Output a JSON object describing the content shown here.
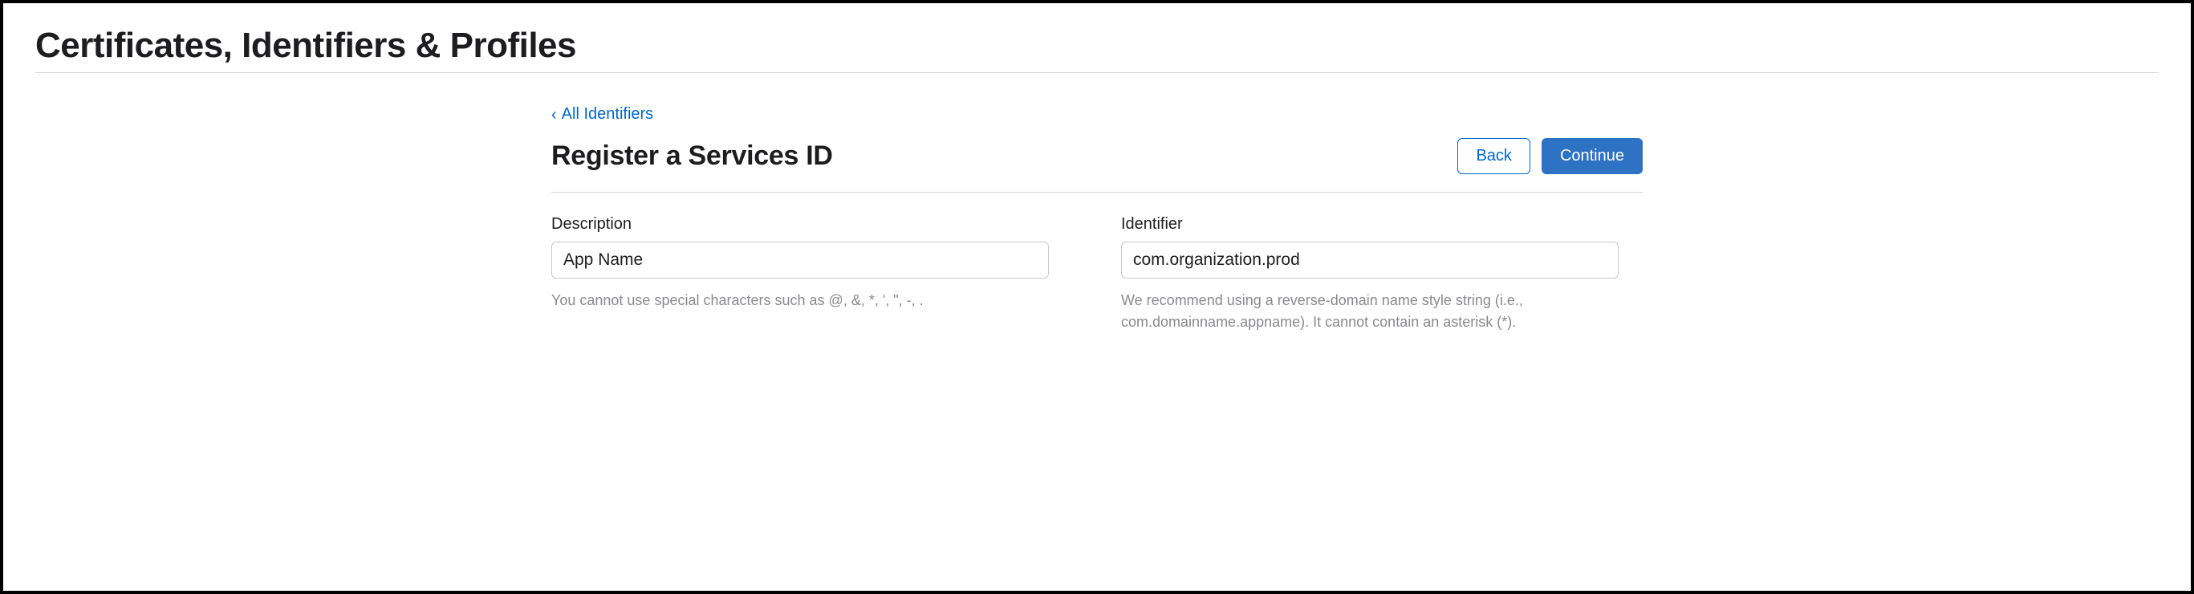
{
  "page": {
    "title": "Certificates, Identifiers & Profiles"
  },
  "nav": {
    "back_link_label": "All Identifiers"
  },
  "header": {
    "section_title": "Register a Services ID",
    "back_button_label": "Back",
    "continue_button_label": "Continue"
  },
  "form": {
    "description": {
      "label": "Description",
      "value": "App Name",
      "hint": "You cannot use special characters such as @, &, *, ', \", -, ."
    },
    "identifier": {
      "label": "Identifier",
      "value": "com.organization.prod",
      "hint": "We recommend using a reverse-domain name style string (i.e., com.domainname.appname). It cannot contain an asterisk (*)."
    }
  }
}
